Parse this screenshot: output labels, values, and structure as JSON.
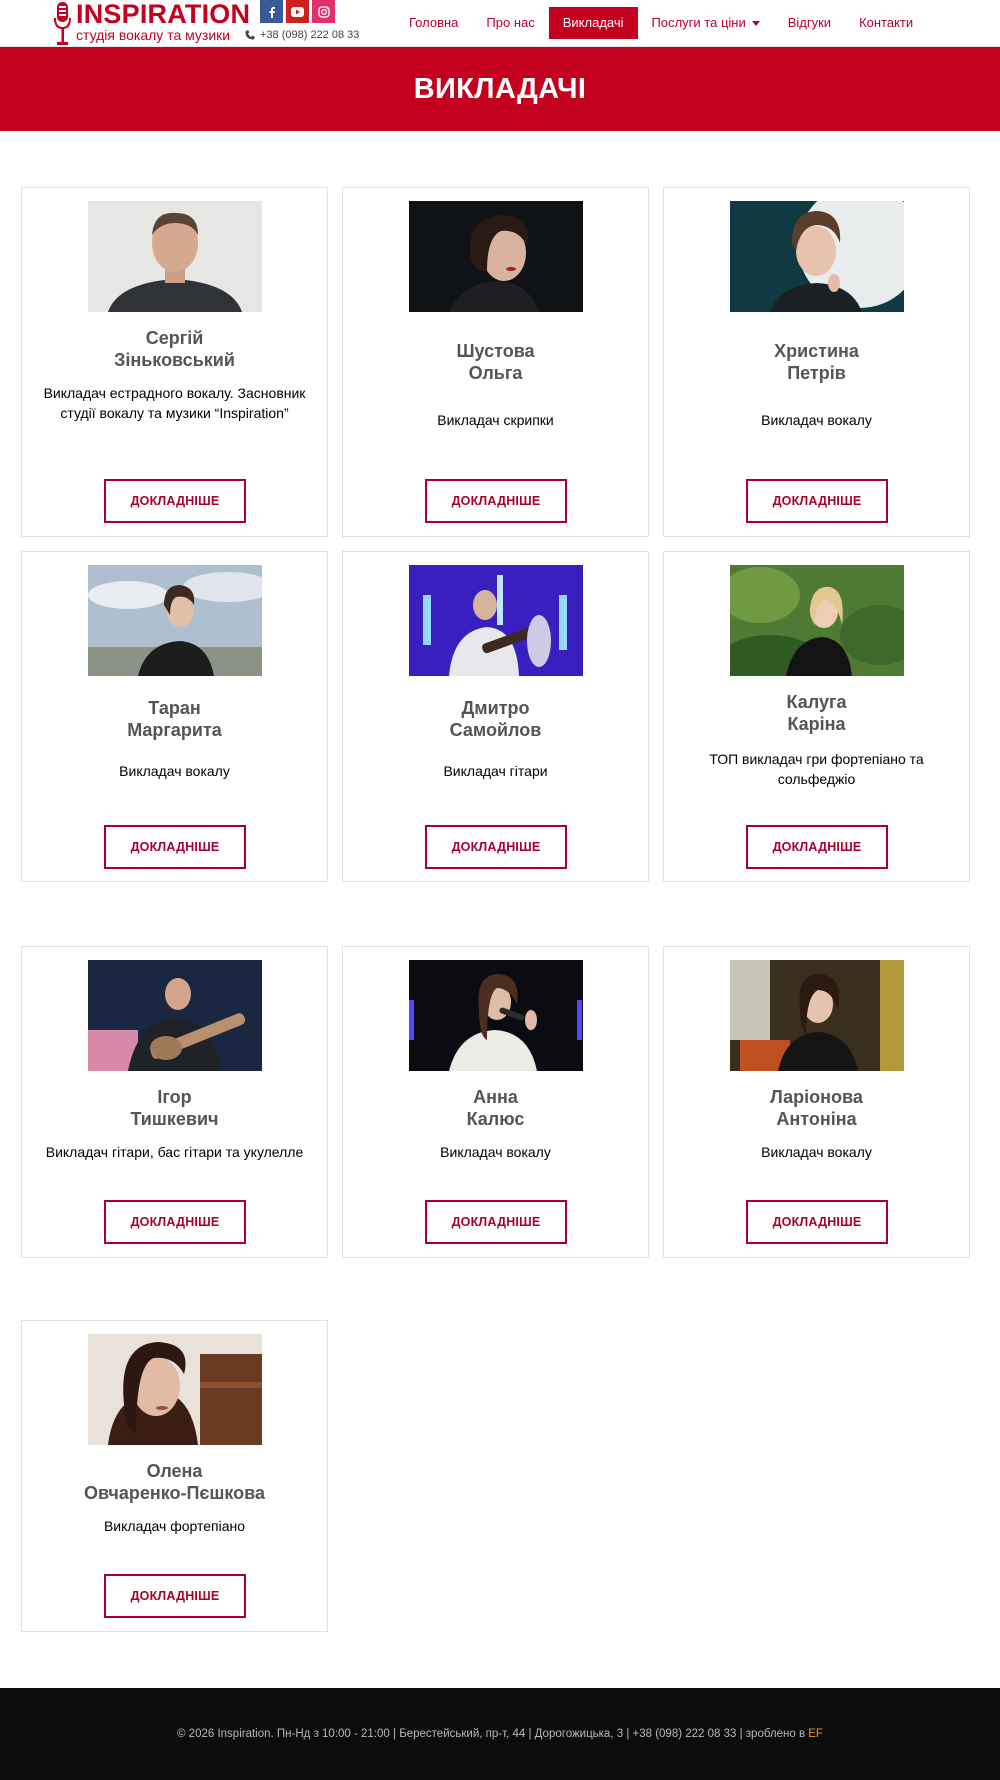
{
  "header": {
    "logo_title": "INSPIRATION",
    "logo_subtitle": "студія вокалу та музики",
    "phone": "+38 (098) 222 08 33",
    "socials": [
      {
        "name": "facebook",
        "glyph": "f",
        "color": "#3b5998"
      },
      {
        "name": "youtube",
        "glyph": "▶",
        "color": "#cd201f"
      },
      {
        "name": "instagram",
        "glyph": "◎",
        "color": "#e1306c"
      }
    ],
    "nav": [
      {
        "label": "Головна",
        "active": false
      },
      {
        "label": "Про нас",
        "active": false
      },
      {
        "label": "Викладачі",
        "active": true
      },
      {
        "label": "Послуги та ціни",
        "active": false,
        "has_dropdown": true
      },
      {
        "label": "Відгуки",
        "active": false
      },
      {
        "label": "Контакти",
        "active": false
      }
    ]
  },
  "banner": {
    "title": "ВИКЛАДАЧІ"
  },
  "teachers": [
    {
      "name_line1": "Сергій",
      "name_line2": "Зіньковський",
      "description": "Викладач естрадного вокалу. Засновник студії вокалу та музики “Inspiration”",
      "button": "ДОКЛАДНІШЕ"
    },
    {
      "name_line1": "Шустова",
      "name_line2": "Ольга",
      "description": "Викладач скрипки",
      "button": "ДОКЛАДНІШЕ"
    },
    {
      "name_line1": "Христина",
      "name_line2": "Петрів",
      "description": "Викладач вокалу",
      "button": "ДОКЛАДНІШЕ"
    },
    {
      "name_line1": "Таран",
      "name_line2": "Маргарита",
      "description": "Викладач вокалу",
      "button": "ДОКЛАДНІШЕ"
    },
    {
      "name_line1": "Дмитро",
      "name_line2": "Самойлов",
      "description": "Викладач гітари",
      "button": "ДОКЛАДНІШЕ"
    },
    {
      "name_line1": "Калуга",
      "name_line2": "Каріна",
      "description": "ТОП викладач гри фортепіано та сольфеджіо",
      "button": "ДОКЛАДНІШЕ"
    },
    {
      "name_line1": "Ігор",
      "name_line2": "Тишкевич",
      "description": "Викладач гітари, бас гітари та укулелле",
      "button": "ДОКЛАДНІШЕ"
    },
    {
      "name_line1": "Анна",
      "name_line2": "Калюс",
      "description": "Викладач вокалу",
      "button": "ДОКЛАДНІШЕ"
    },
    {
      "name_line1": "Ларіонова",
      "name_line2": "Антоніна",
      "description": "Викладач вокалу",
      "button": "ДОКЛАДНІШЕ"
    },
    {
      "name_line1": "Олена",
      "name_line2": "Овчаренко-Пєшкова",
      "description": "Викладач фортепіано",
      "button": "ДОКЛАДНІШЕ"
    }
  ],
  "footer": {
    "text": "© 2026 Inspiration. Пн-Нд з 10:00 - 21:00 | Берестейський, пр-т, 44 | Дорогожицька, 3 | +38 (098) 222 08 33 | зроблено в ",
    "brand": "EF"
  },
  "colors": {
    "brand_red": "#c4001f",
    "button_red": "#a8002a",
    "footer_bg": "#0c0c0c"
  }
}
